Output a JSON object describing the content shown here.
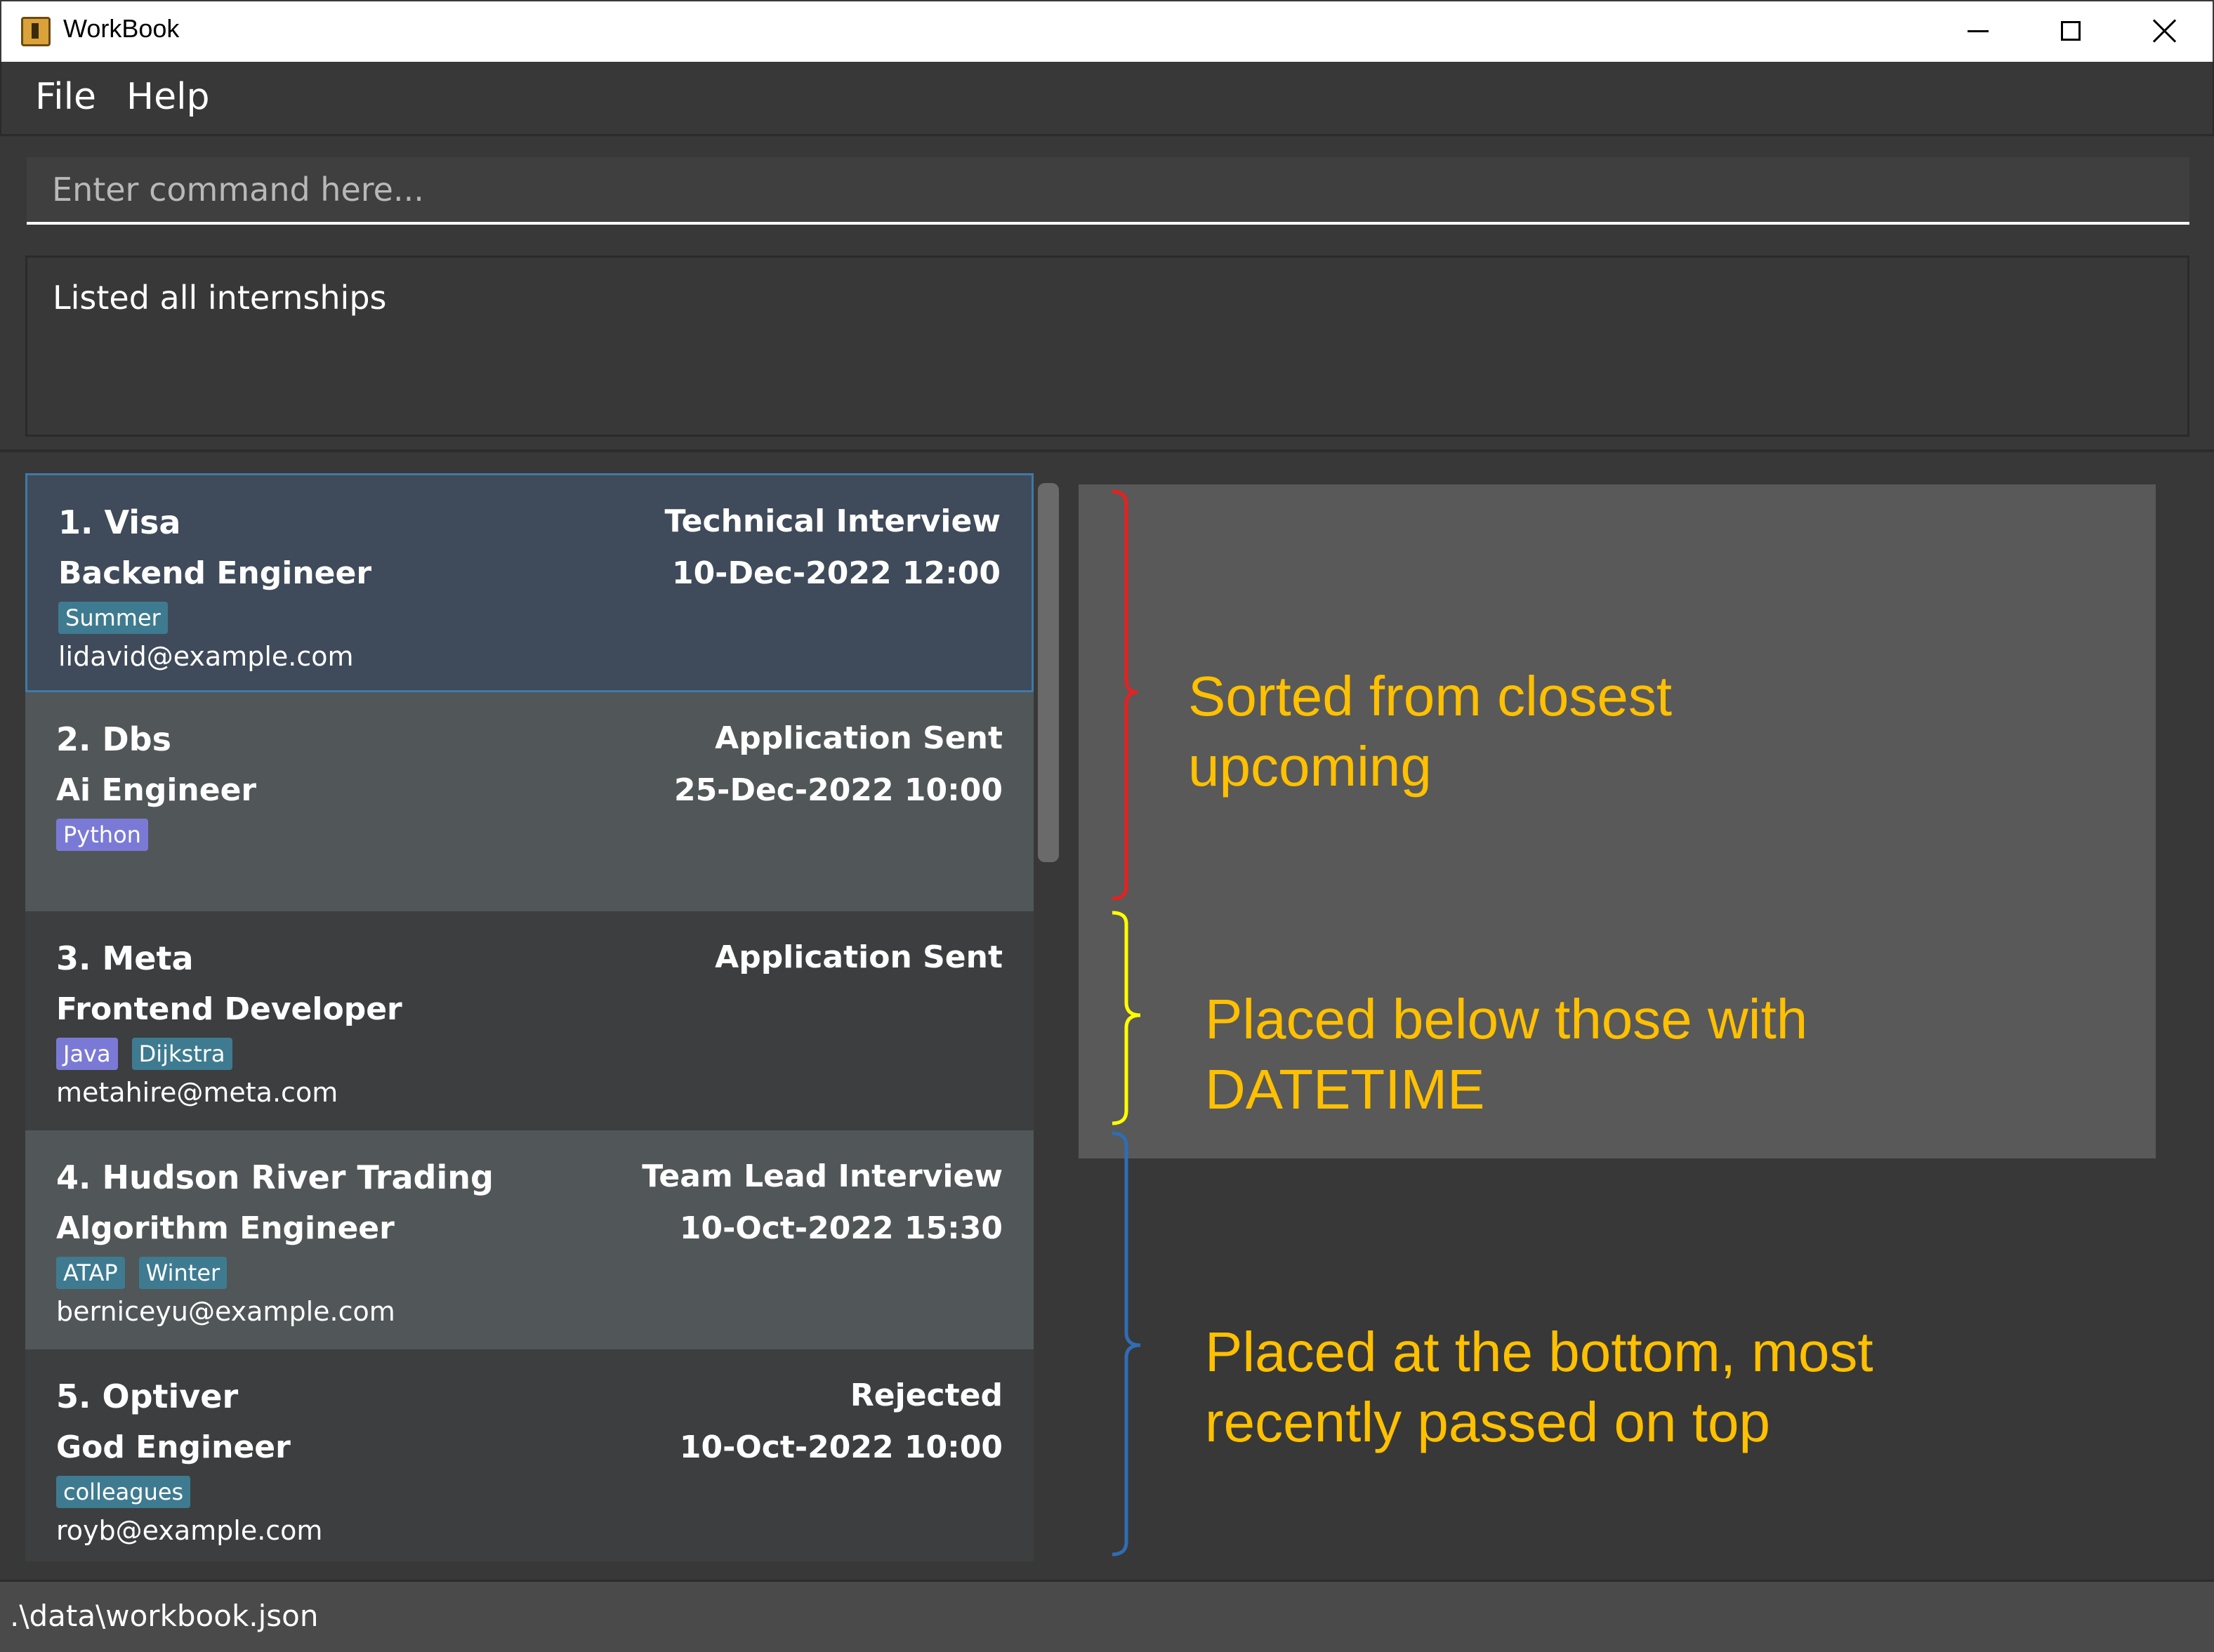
{
  "window": {
    "title": "WorkBook"
  },
  "menu": {
    "file": "File",
    "help": "Help"
  },
  "command": {
    "placeholder": "Enter command here..."
  },
  "result": {
    "text": "Listed all internships"
  },
  "internships": [
    {
      "name": "1.  Visa",
      "role": "Backend Engineer",
      "stage": "Technical Interview",
      "datetime": "10-Dec-2022 12:00",
      "tags": [
        "Summer"
      ],
      "email": "lidavid@example.com"
    },
    {
      "name": "2.  Dbs",
      "role": "Ai Engineer",
      "stage": "Application Sent",
      "datetime": "25-Dec-2022 10:00",
      "tags": [
        "Python"
      ],
      "email": ""
    },
    {
      "name": "3.  Meta",
      "role": "Frontend Developer",
      "stage": "Application Sent",
      "datetime": "",
      "tags": [
        "Java",
        "Dijkstra"
      ],
      "email": "metahire@meta.com"
    },
    {
      "name": "4.  Hudson River Trading",
      "role": "Algorithm Engineer",
      "stage": "Team Lead Interview",
      "datetime": "10-Oct-2022 15:30",
      "tags": [
        "ATAP",
        "Winter"
      ],
      "email": "berniceyu@example.com"
    },
    {
      "name": "5.  Optiver",
      "role": "God Engineer",
      "stage": "Rejected",
      "datetime": "10-Oct-2022 10:00",
      "tags": [
        "colleagues"
      ],
      "email": "royb@example.com"
    }
  ],
  "annotations": {
    "upcoming_line1": "Sorted from closest",
    "upcoming_line2": "upcoming",
    "nodate_line1": "Placed below those with",
    "nodate_line2": "DATETIME",
    "passed_line1": "Placed at the bottom, most",
    "passed_line2": "recently passed on top",
    "colors": {
      "text": "#ffc000",
      "upcoming_bracket": "#e8201f",
      "nodate_bracket": "#ffff00",
      "passed_bracket": "#2f6db5"
    }
  },
  "status": {
    "path": ".\\data\\workbook.json"
  }
}
